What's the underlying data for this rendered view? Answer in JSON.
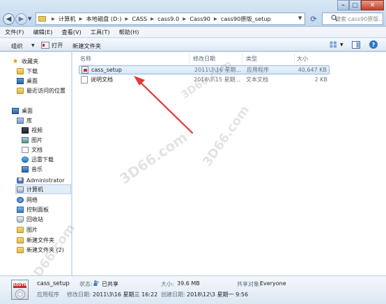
{
  "address_bar": {
    "breadcrumbs": [
      "计算机",
      "本地磁盘 (D:)",
      "CASS",
      "cass9.0",
      "Cass90",
      "cass90原版_setup"
    ],
    "search_placeholder": "搜索 cass90原版..."
  },
  "menu": [
    "文件(F)",
    "编辑(E)",
    "查看(V)",
    "工具(T)",
    "帮助(H)"
  ],
  "toolbar": {
    "organize": "组织",
    "open": "打开",
    "new_folder": "新建文件夹"
  },
  "nav": {
    "favorites": "收藏夹",
    "downloads": "下载",
    "desktop_fav": "桌面",
    "recent": "最近访问的位置",
    "desktop": "桌面",
    "libraries": "库",
    "videos": "视频",
    "pictures": "图片",
    "documents": "文档",
    "thunder": "迅雷下载",
    "music": "音乐",
    "admin": "Administrator",
    "computer": "计算机",
    "network": "网络",
    "control_panel": "控制面板",
    "recycle_bin": "回收站",
    "pictures2": "图片",
    "new_folder": "新建文件夹",
    "new_folder2": "新建文件夹 (2)"
  },
  "columns": {
    "name": "名称",
    "date": "修改日期",
    "type": "类型",
    "size": "大小"
  },
  "files": [
    {
      "name": "cass_setup",
      "date": "2011\\3\\16 星期...",
      "type": "应用程序",
      "size": "40,647 KB"
    },
    {
      "name": "说明文档",
      "date": "2018\\3\\15 星期...",
      "type": "文本文档",
      "size": "2 KB"
    }
  ],
  "details": {
    "name": "cass_setup",
    "type": "应用程序",
    "state_label": "状态:",
    "state_value": "已共享",
    "modified_label": "修改日期:",
    "modified_value": "2011\\3\\16 星期三 16:22",
    "size_label": "大小:",
    "size_value": "39.6 MB",
    "created_label": "创建日期:",
    "created_value": "2018\\12\\3 星期一 9:56",
    "share_label": "共享对象:",
    "share_value": "Everyone",
    "icon_badge": "SOUTH"
  },
  "watermarks": [
    "3D66.com",
    "3D66.com",
    "3D66.com",
    "3D66.com"
  ],
  "colors": {
    "annotation_arrow": "#e0393b",
    "selection": "#d6e7f9"
  }
}
